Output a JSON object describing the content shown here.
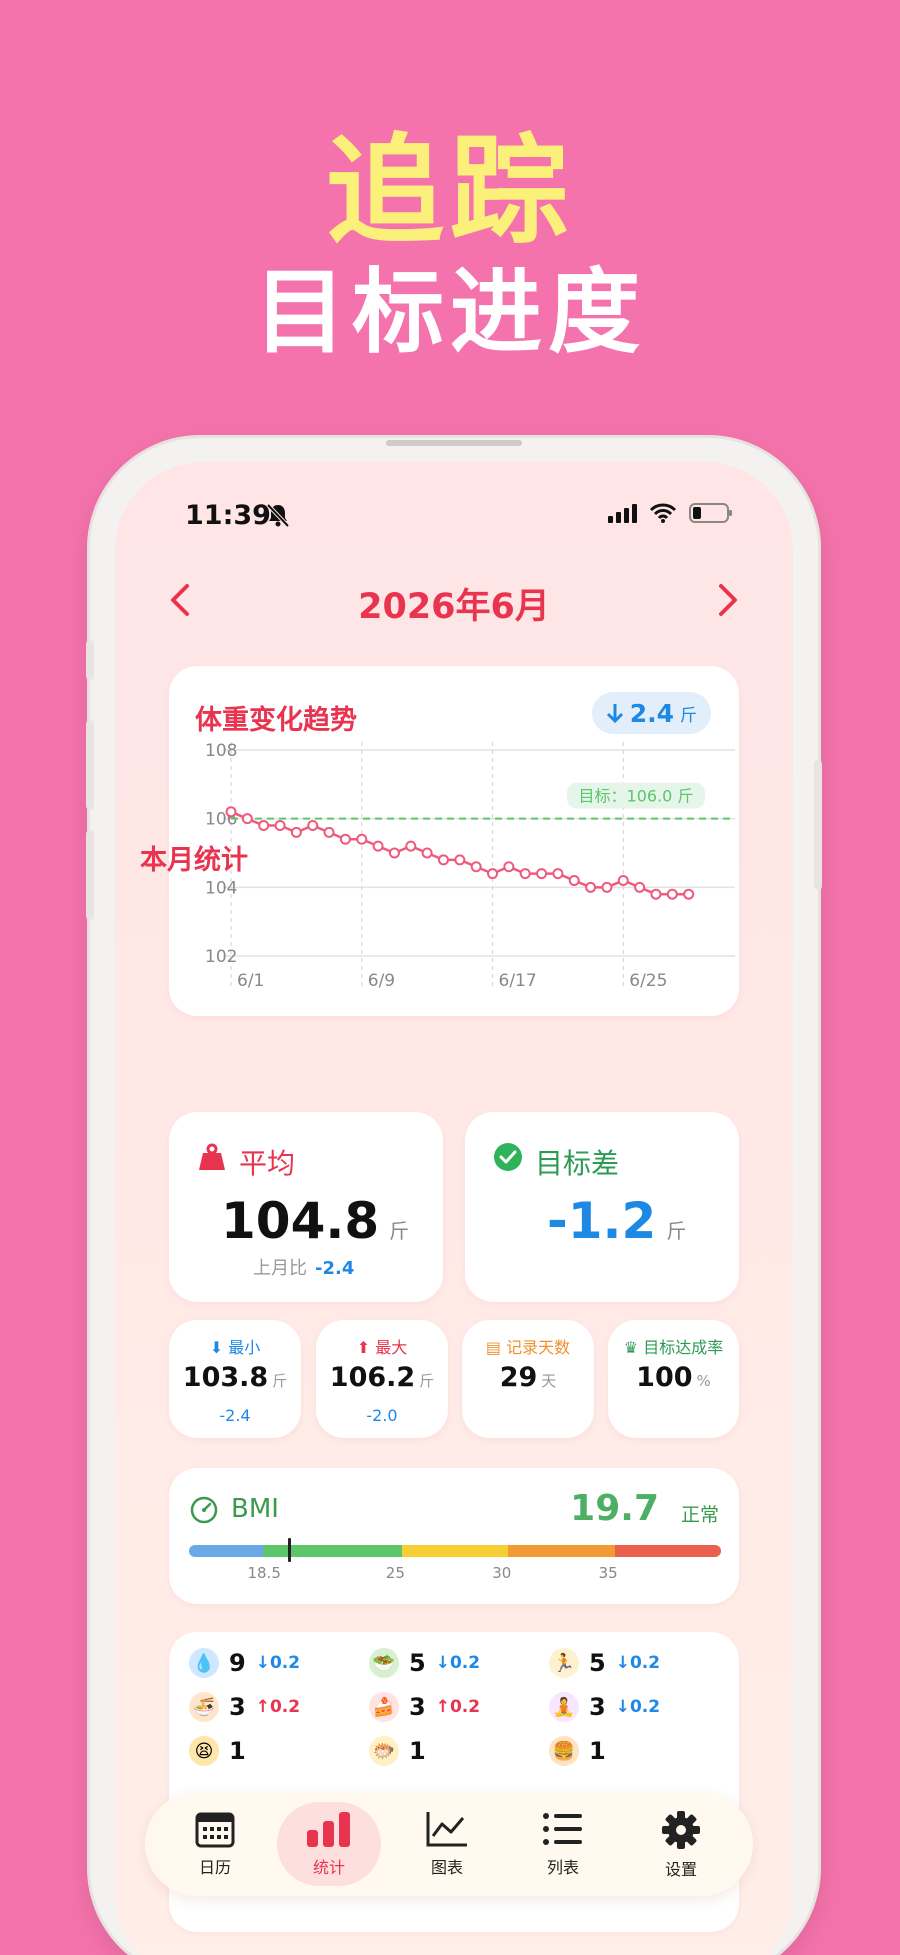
{
  "promo": {
    "line1": "追踪",
    "line2": "目标进度"
  },
  "status_bar": {
    "time": "11:39"
  },
  "header": {
    "title": "2026年6月"
  },
  "weight_chart": {
    "title": "体重变化趋势",
    "badge_value": "2.4",
    "badge_unit": "斤",
    "target_label": "目标：106.0 斤",
    "y_ticks": [
      "108",
      "106",
      "104",
      "102"
    ],
    "x_ticks": [
      "6/1",
      "6/9",
      "6/17",
      "6/25"
    ]
  },
  "chart_data": {
    "type": "line",
    "title": "体重变化趋势",
    "x": [
      1,
      2,
      3,
      4,
      5,
      6,
      7,
      8,
      9,
      10,
      11,
      12,
      13,
      14,
      15,
      16,
      17,
      18,
      19,
      20,
      21,
      22,
      23,
      24,
      25,
      26,
      27,
      28,
      29
    ],
    "x_tick_labels": [
      "6/1",
      "6/9",
      "6/17",
      "6/25"
    ],
    "series": [
      {
        "values": [
          106.2,
          106.0,
          105.8,
          105.8,
          105.6,
          105.8,
          105.6,
          105.4,
          105.4,
          105.2,
          105.0,
          105.2,
          105.0,
          104.8,
          104.8,
          104.6,
          104.4,
          104.6,
          104.4,
          104.4,
          104.4,
          104.2,
          104.0,
          104.0,
          104.2,
          104.0,
          103.8,
          103.8,
          103.8
        ]
      }
    ],
    "target": 106.0,
    "ylim": [
      102,
      108
    ],
    "y_ticks": [
      102,
      104,
      106,
      108
    ],
    "grid": true
  },
  "monthly": {
    "section_title": "本月统计",
    "average": {
      "label": "平均",
      "value": "104.8",
      "unit": "斤",
      "sub_label": "上月比",
      "sub_value": "-2.4"
    },
    "target_diff": {
      "label": "目标差",
      "value": "-1.2",
      "unit": "斤"
    },
    "min": {
      "label": "最小",
      "value": "103.8",
      "unit": "斤",
      "delta": "-2.4"
    },
    "max": {
      "label": "最大",
      "value": "106.2",
      "unit": "斤",
      "delta": "-2.0"
    },
    "days": {
      "label": "记录天数",
      "value": "29",
      "unit": "天"
    },
    "rate": {
      "label": "目标达成率",
      "value": "100",
      "unit": "%"
    }
  },
  "bmi": {
    "label": "BMI",
    "value": "19.7",
    "status": "正常",
    "ticks": [
      "18.5",
      "25",
      "30",
      "35"
    ],
    "marker_value": 19.7,
    "colors": [
      "#6aa8e8",
      "#5cc66a",
      "#f5cf34",
      "#f39a35",
      "#ea5f4e"
    ]
  },
  "habits": [
    {
      "icon": "water-drop-icon",
      "count": "9",
      "delta": "↓0.2",
      "dir": "down"
    },
    {
      "icon": "salad-icon",
      "count": "5",
      "delta": "↓0.2",
      "dir": "down"
    },
    {
      "icon": "running-icon",
      "count": "5",
      "delta": "↓0.2",
      "dir": "down"
    },
    {
      "icon": "noodles-icon",
      "count": "3",
      "delta": "↑0.2",
      "dir": "up"
    },
    {
      "icon": "cake-icon",
      "count": "3",
      "delta": "↑0.2",
      "dir": "up"
    },
    {
      "icon": "yoga-icon",
      "count": "3",
      "delta": "↓0.2",
      "dir": "down"
    },
    {
      "icon": "tired-face-icon",
      "count": "1",
      "delta": "",
      "dir": ""
    },
    {
      "icon": "pufferfish-icon",
      "count": "1",
      "delta": "",
      "dir": ""
    },
    {
      "icon": "burger-icon",
      "count": "1",
      "delta": "",
      "dir": ""
    }
  ],
  "tabbar": {
    "items": [
      {
        "label": "日历",
        "icon": "calendar-icon"
      },
      {
        "label": "统计",
        "icon": "bar-chart-icon",
        "active": true
      },
      {
        "label": "图表",
        "icon": "line-chart-icon"
      },
      {
        "label": "列表",
        "icon": "list-icon"
      },
      {
        "label": "设置",
        "icon": "gear-icon"
      }
    ]
  }
}
